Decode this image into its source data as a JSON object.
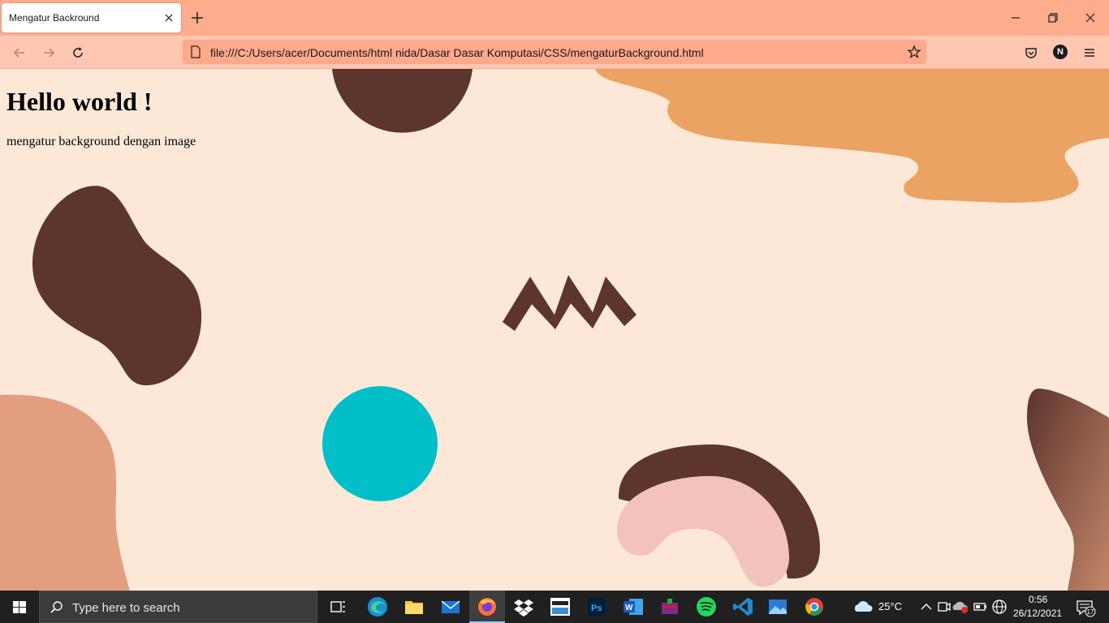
{
  "browser": {
    "tab_title": "Mengatur Backround",
    "url": "file:///C:/Users/acer/Documents/html nida/Dasar Dasar Komputasi/CSS/mengaturBackground.html",
    "profile_initial": "N",
    "accent": "#fdac8c"
  },
  "page": {
    "heading": "Hello world !",
    "paragraph": "mengatur background dengan image",
    "background_color": "#fde8d7"
  },
  "taskbar": {
    "search_placeholder": "Type here to search",
    "weather": "25°C",
    "time": "0:56",
    "date": "26/12/2021",
    "notification_count": "17",
    "apps": [
      "task-view-icon",
      "edge-icon",
      "file-explorer-icon",
      "mail-icon",
      "firefox-icon",
      "dropbox-icon",
      "amazon-icon",
      "photoshop-icon",
      "word-icon",
      "winrar-icon",
      "spotify-icon",
      "vscode-icon",
      "photos-icon",
      "chrome-icon"
    ]
  }
}
